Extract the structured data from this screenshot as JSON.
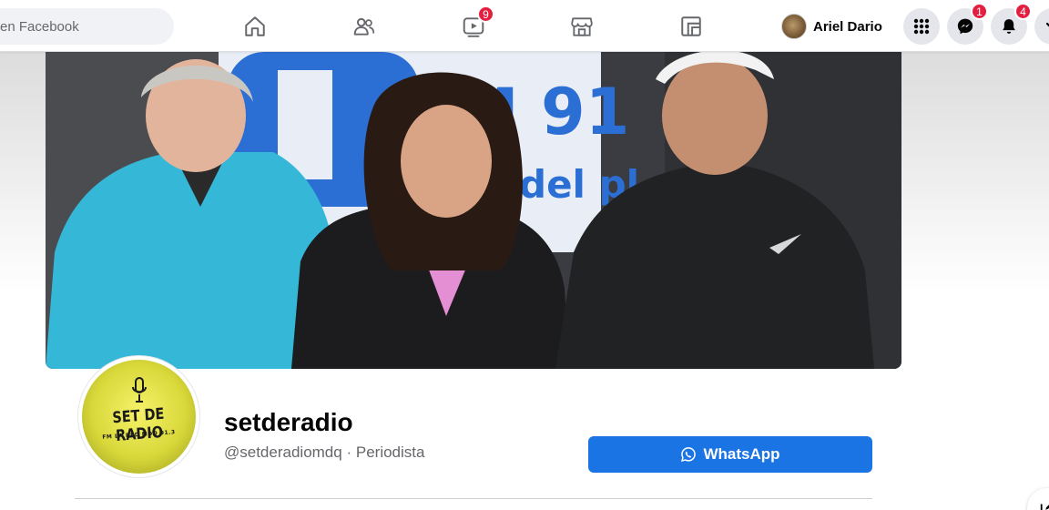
{
  "topbar": {
    "search_placeholder": "en Facebook",
    "nav": [
      {
        "name": "home",
        "icon": "home-icon"
      },
      {
        "name": "friends",
        "icon": "friends-icon"
      },
      {
        "name": "watch",
        "icon": "video-icon",
        "badge": "9"
      },
      {
        "name": "marketplace",
        "icon": "store-icon"
      },
      {
        "name": "gaming",
        "icon": "gaming-icon"
      }
    ],
    "profile_name": "Ariel Dario",
    "messenger_badge": "1",
    "notifications_badge": "4"
  },
  "page": {
    "name": "setderadio",
    "handle": "@setderadiomdq",
    "separator": "·",
    "category": "Periodista",
    "whatsapp_label": "WhatsApp",
    "logo_main": "SET DE RADIO",
    "logo_sub": "FM LA RED MDQ 91.3"
  },
  "colors": {
    "accent": "#1b74e4",
    "badge": "#e41e3f"
  }
}
